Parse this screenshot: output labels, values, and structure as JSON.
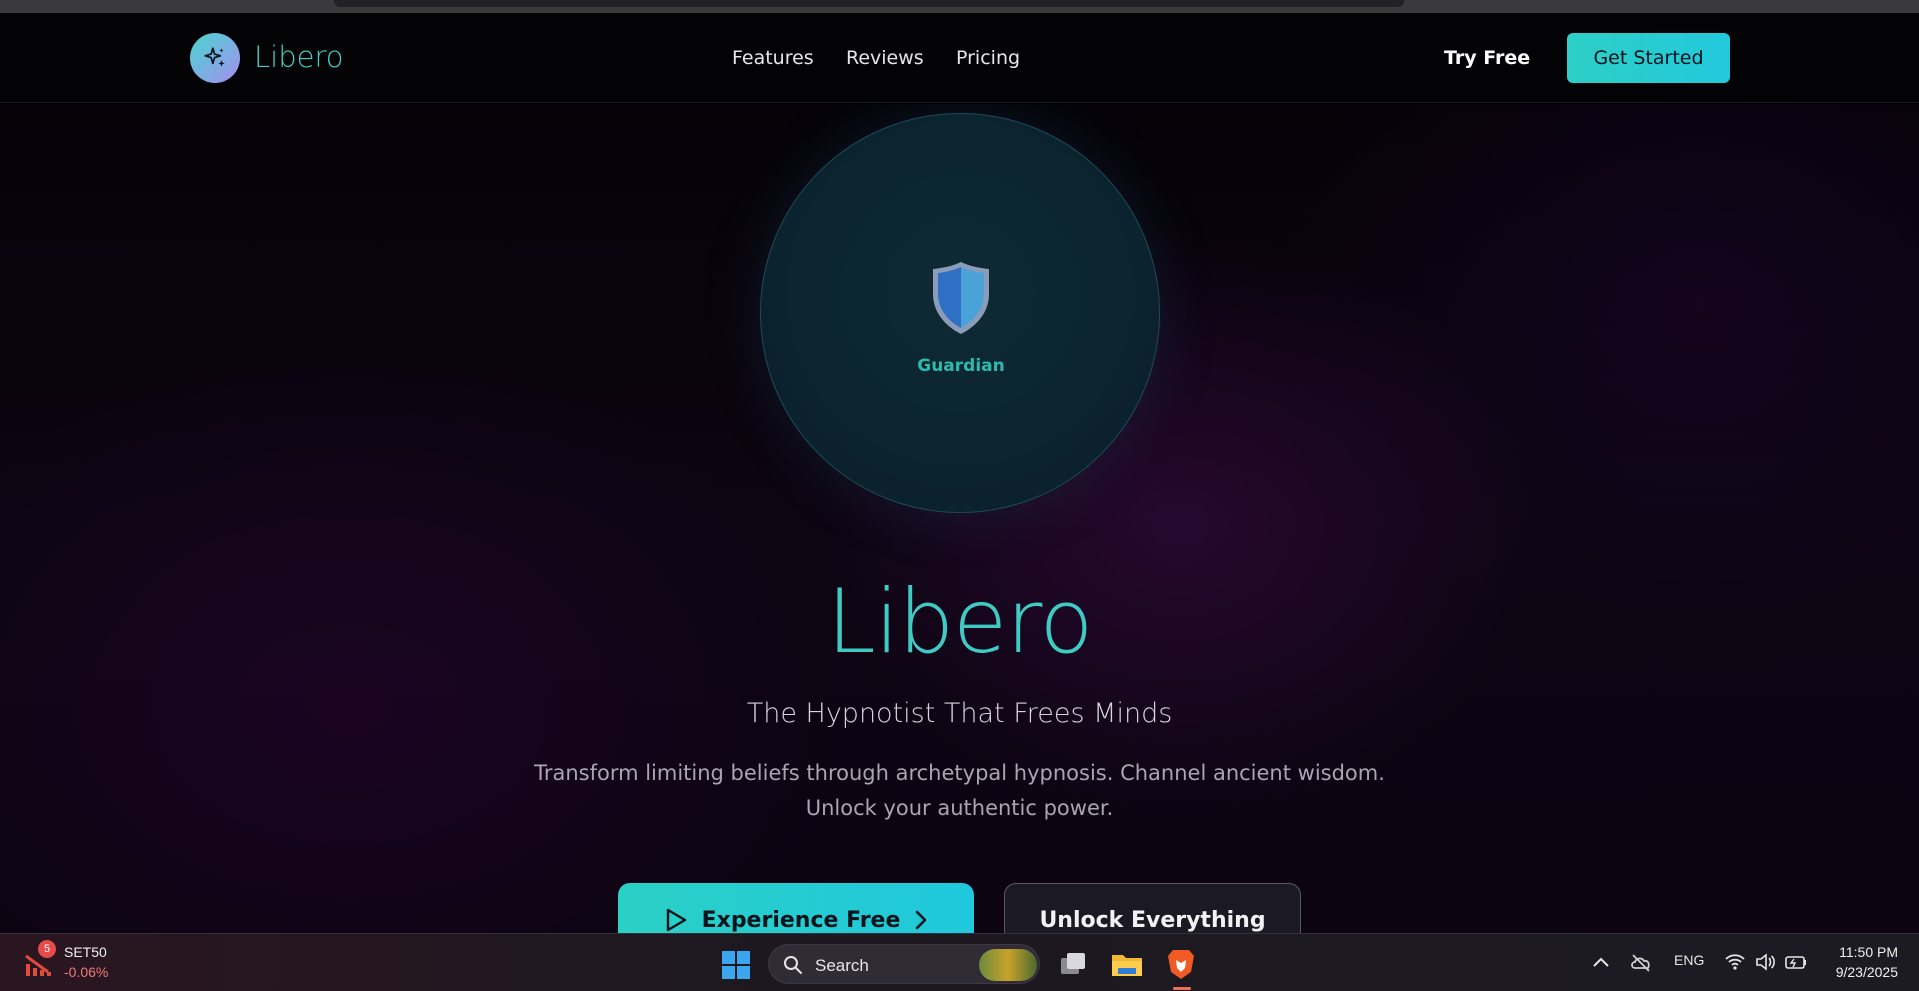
{
  "nav": {
    "brand": "Libero",
    "links": [
      "Features",
      "Reviews",
      "Pricing"
    ],
    "try_free": "Try Free",
    "get_started": "Get Started"
  },
  "hero": {
    "orb_label": "Guardian",
    "title": "Libero",
    "subtitle": "The Hypnotist That Frees Minds",
    "description_line1": "Transform limiting beliefs through archetypal hypnosis. Channel ancient wisdom.",
    "description_line2": "Unlock your authentic power.",
    "primary_button": "Experience Free",
    "secondary_button": "Unlock Everything"
  },
  "taskbar": {
    "ticker_name": "SET50",
    "ticker_change": "-0.06%",
    "ticker_badge": "5",
    "search_label": "Search",
    "language": "ENG",
    "time": "11:50 PM",
    "date": "9/23/2025"
  },
  "colors": {
    "accent": "#3fcbc3",
    "button_gradient": "#2bd0c5"
  }
}
